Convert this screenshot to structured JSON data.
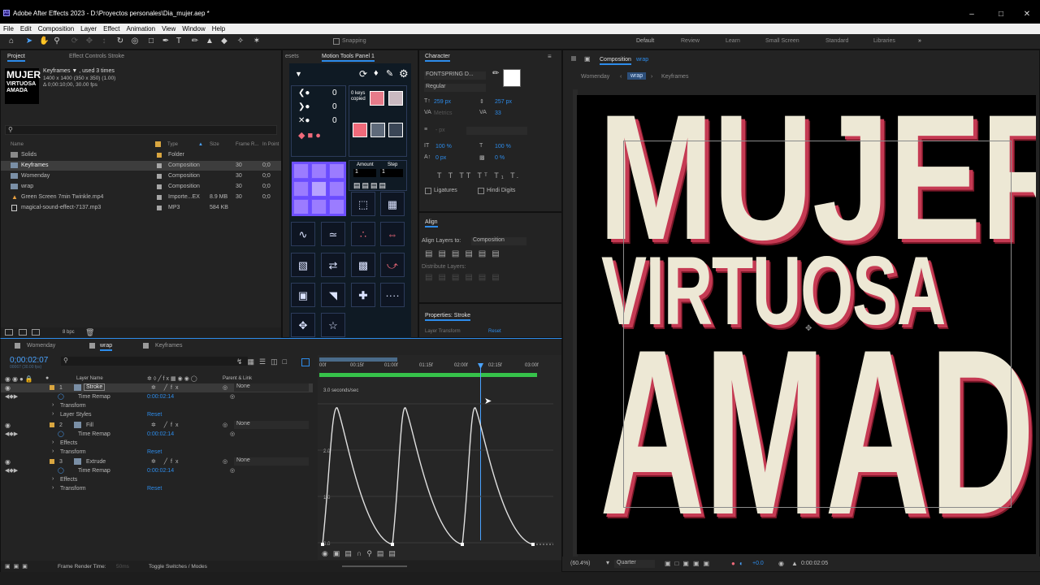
{
  "title": "Adobe After Effects 2023 - D:\\Proyectos personales\\Dia_mujer.aep *",
  "menu": [
    "File",
    "Edit",
    "Composition",
    "Layer",
    "Effect",
    "Animation",
    "View",
    "Window",
    "Help"
  ],
  "snapping": "Snapping",
  "workspaces": [
    "Default",
    "Review",
    "Learn",
    "Small Screen",
    "Standard",
    "Libraries"
  ],
  "project": {
    "tab": "Project",
    "tab2": "Effect Controls Stroke",
    "thumb_lines": [
      "MUJER",
      "VIRTUOSA",
      "AMADA"
    ],
    "sel_name": "Keyframes ▼ , used 3 times",
    "sel_info1": "1400 x 1400  (350 x 350) (1.00)",
    "sel_info2": "Δ 0;00:10;00, 30.00 fps",
    "search": "",
    "cols": [
      "Name",
      "Type",
      "Size",
      "Frame R...",
      "In Point"
    ],
    "items": [
      {
        "name": "Solids",
        "type": "Folder",
        "size": "",
        "fr": "",
        "in": ""
      },
      {
        "name": "Keyframes",
        "type": "Composition",
        "size": "",
        "fr": "30",
        "in": "0;0"
      },
      {
        "name": "Womenday",
        "type": "Composition",
        "size": "",
        "fr": "30",
        "in": "0;0"
      },
      {
        "name": "wrap",
        "type": "Composition",
        "size": "",
        "fr": "30",
        "in": "0;0"
      },
      {
        "name": "Green Screen 7min Twinkle.mp4",
        "type": "Importe...EX",
        "size": "8.9 MB",
        "fr": "30",
        "in": "0;0"
      },
      {
        "name": "magical-sound-effect-7137.mp3",
        "type": "MP3",
        "size": "584 KB",
        "fr": "",
        "in": ""
      }
    ],
    "bpc": "8 bpc"
  },
  "motion": {
    "tab1": "esets",
    "tab2": "Motion Tools Panel 1",
    "counters": [
      "0",
      "0",
      "0"
    ],
    "keys_label": "0 keys\ncopied",
    "amount": "Amount",
    "step": "Step",
    "amount_val": "1",
    "step_val": "1"
  },
  "character": {
    "tab": "Character",
    "font": "FONTSPRING D...",
    "style": "Regular",
    "size": "259 px",
    "leading": "257 px",
    "kerning": "Metrics",
    "tracking": "33",
    "stroke": "- px",
    "vscale": "100 %",
    "hscale": "100 %",
    "baseline": "0 px",
    "tsume": "0 %",
    "ligatures": "Ligatures",
    "hindi": "Hindi Digits"
  },
  "align": {
    "tab": "Align",
    "align_to": "Align Layers to:",
    "align_to_val": "Composition",
    "distribute": "Distribute Layers:"
  },
  "properties": {
    "tab": "Properties: Stroke",
    "transform": "Layer Transform",
    "reset": "Reset"
  },
  "timeline": {
    "tabs": [
      "Womenday",
      "wrap",
      "Keyframes"
    ],
    "timecode": "0;00:02:07",
    "fps": "00067 (30.00 fps)",
    "col_layer": "Layer Name",
    "col_parent": "Parent & Link",
    "ruler": [
      "00f",
      "00:15f",
      "01:00f",
      "01:15f",
      "02:00f",
      "02:15f",
      "03:00f"
    ],
    "graph_label": "3.0 seconds/sec",
    "graph_y": [
      "2.0",
      "1.0",
      "0.0"
    ],
    "layers": [
      {
        "num": "1",
        "name": "Stroke",
        "parent": "None",
        "prop": "Time Remap",
        "val": "0:00:02:14",
        "sub1": "Transform",
        "sub2": "Layer Styles",
        "reset": "Reset"
      },
      {
        "num": "2",
        "name": "Fill",
        "parent": "None",
        "prop": "Time Remap",
        "val": "0:00:02:14",
        "sub1": "Effects",
        "sub2": "Transform",
        "reset": "Reset"
      },
      {
        "num": "3",
        "name": "Extrude",
        "parent": "None",
        "prop": "Time Remap",
        "val": "0:00:02:14",
        "sub1": "Effects",
        "sub2": "Transform",
        "reset": "Reset"
      }
    ],
    "frame_render": "Frame Render Time:",
    "frame_render_val": "50ms",
    "toggle": "Toggle Switches / Modes"
  },
  "comp": {
    "tab": "Composition",
    "tab_name": "wrap",
    "crumbs": [
      "Womenday",
      "wrap",
      "Keyframes"
    ],
    "words": [
      "MUJER",
      "VIRTUOSA",
      "AMADA"
    ],
    "zoom": "(60.4%)",
    "quality": "Quarter",
    "exposure": "+0.0",
    "time": "0:00:02:05",
    "text_color": "#ede8d5",
    "shadow_color": "#c53a53"
  }
}
